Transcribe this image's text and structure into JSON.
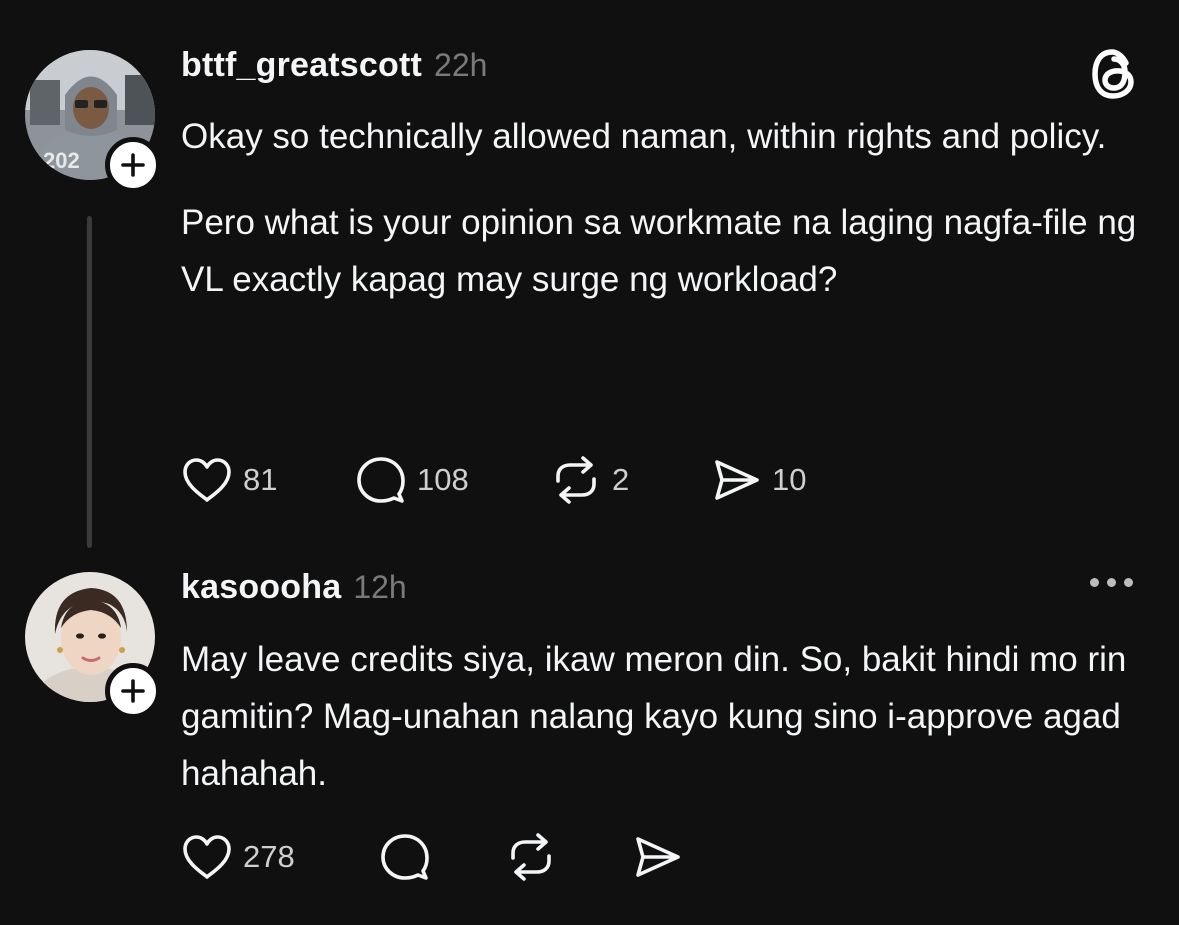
{
  "posts": [
    {
      "username": "bttf_greatscott",
      "timestamp": "22h",
      "avatar_text": "202",
      "paragraphs": [
        "Okay so technically allowed naman, within rights and policy.",
        "Pero what is your opinion sa workmate na laging nagfa-file ng VL exactly kapag may surge ng workload?"
      ],
      "likes": "81",
      "replies": "108",
      "reposts": "2",
      "shares": "10"
    },
    {
      "username": "kasoooha",
      "timestamp": "12h",
      "paragraphs": [
        "May leave credits siya, ikaw meron din. So, bakit hindi mo rin gamitin? Mag-unahan nalang kayo kung sino i-approve agad hahahah."
      ],
      "likes": "278"
    }
  ],
  "icons": {
    "app_logo": "threads-logo-icon",
    "follow": "plus-icon",
    "like": "heart-icon",
    "reply": "comment-icon",
    "repost": "repost-icon",
    "share": "send-icon",
    "more": "more-dots-icon"
  },
  "colors": {
    "background": "#101010",
    "text": "#f3f5f7",
    "muted": "#7a7a7a",
    "thread_line": "#3a3a3a"
  }
}
